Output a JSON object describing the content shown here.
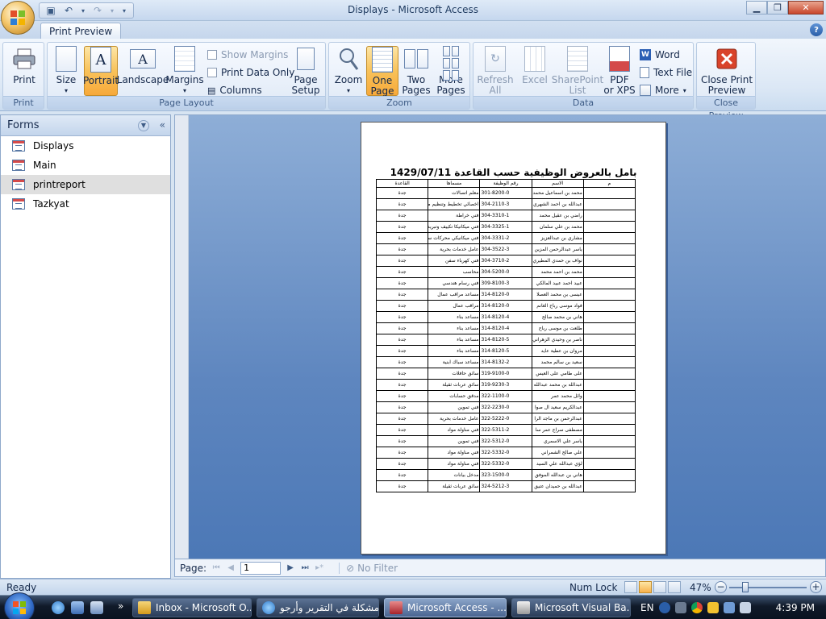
{
  "window": {
    "title": "Displays - Microsoft Access",
    "minimize_glyph": "▁",
    "restore_glyph": "❐",
    "close_glyph": "✕"
  },
  "ribbon": {
    "active_tab": "Print Preview",
    "help_glyph": "?",
    "groups": {
      "print": {
        "label": "Print",
        "print_btn": "Print"
      },
      "page_layout": {
        "label": "Page Layout",
        "size": "Size",
        "portrait": "Portrait",
        "landscape": "Landscape",
        "margins": "Margins",
        "show_margins": "Show Margins",
        "print_data_only": "Print Data Only",
        "columns": "Columns",
        "page_setup_1": "Page",
        "page_setup_2": "Setup"
      },
      "zoom": {
        "label": "Zoom",
        "zoom": "Zoom",
        "one_page_1": "One",
        "one_page_2": "Page",
        "two_pages_1": "Two",
        "two_pages_2": "Pages",
        "more_pages_1": "More",
        "more_pages_2": "Pages"
      },
      "data": {
        "label": "Data",
        "refresh_1": "Refresh",
        "refresh_2": "All",
        "excel": "Excel",
        "sharepoint_1": "SharePoint",
        "sharepoint_2": "List",
        "pdf_1": "PDF",
        "pdf_2": "or XPS",
        "word": "Word",
        "text_file": "Text File",
        "more": "More"
      },
      "close_preview": {
        "label": "Close Preview",
        "btn_1": "Close Print",
        "btn_2": "Preview"
      }
    }
  },
  "nav_pane": {
    "header": "Forms",
    "items": [
      "Displays",
      "Main",
      "printreport",
      "Tazkyat"
    ],
    "selected_index": 2
  },
  "report": {
    "title": "بامل بالعروض الوظيفية حسب القاعدة 1429/07/11",
    "headers": {
      "idx": "م",
      "name": "الاسم",
      "job_no": "رقم الوظيفة",
      "title": "مسماها",
      "base": "القاعدة"
    },
    "rows": [
      [
        "محمد بن اسماعيل محمد",
        "301-8200-0",
        "معلم اتصالات",
        "جدة"
      ],
      [
        "عبدالله بن احمد الشهري",
        "304-2110-3",
        "اخصائي تخطيط وتنظيم ميكانيكا",
        "جدة"
      ],
      [
        "راضي بن عقيل محمد",
        "304-3310-1",
        "فني خراطة",
        "جدة"
      ],
      [
        "محمد بن علي سلمان",
        "304-3325-1",
        "فني ميكانيكا تكييف وتبريد",
        "جدة"
      ],
      [
        "مشاري بن عبدالعزيز",
        "304-3331-2",
        "فني ميكانيكي محركات سفن",
        "جدة"
      ],
      [
        "ياسر عبدالرحمن المزين",
        "304-3522-3",
        "عامل خدمات بحرية",
        "جدة"
      ],
      [
        "نواف بن حمدي المطيري",
        "304-3710-2",
        "فني كهرباء سفن",
        "جدة"
      ],
      [
        "محمد بن احمد محمد",
        "304-5200-0",
        "محاسب",
        "جدة"
      ],
      [
        "عبيد احمد عبيد المالكي",
        "309-8100-3",
        "فني رسام هندسي",
        "جدة"
      ],
      [
        "عيسى بن محمد العصلا",
        "314-8120-0",
        "مساعد مراقب عمال",
        "جدة"
      ],
      [
        "فواد موسى رباح الغانم",
        "314-8120-0",
        "مراقب عمال",
        "جدة"
      ],
      [
        "هاني بن محمد صالح",
        "314-8120-4",
        "مساعد بناء",
        "جدة"
      ],
      [
        "طلعت بن موسى رباح",
        "314-8120-4",
        "مساعد بناء",
        "جدة"
      ],
      [
        "ناصر بن وحيدي الزهراني",
        "314-8120-5",
        "مساعد بناء",
        "جدة"
      ],
      [
        "مروان بن عطية عايد",
        "314-8120-5",
        "مساعد بناء",
        "جدة"
      ],
      [
        "سعيد بن سالم محمد",
        "314-8132-2",
        "مساعد سباك ابنية",
        "جدة"
      ],
      [
        "على طامي على العيس",
        "319-9100-0",
        "سائق حافلات",
        "جدة"
      ],
      [
        "عبدالله بن محمد عبدالله",
        "319-9230-3",
        "سائق عربات ثقيلة",
        "جدة"
      ],
      [
        "وائل محمد عمر",
        "322-1100-0",
        "مدقق حسابات",
        "جدة"
      ],
      [
        "عبدالكريم سعيد ال صوا",
        "322-2230-0",
        "فني تموين",
        "جدة"
      ],
      [
        "عبدالرحمن بن ماجد الرا",
        "322-5222-0",
        "عامل خدمات بحرية",
        "جدة"
      ],
      [
        "مصطفى سراج عمر سا",
        "322-5311-2",
        "فني مناولة مواد",
        "جدة"
      ],
      [
        "ياسر علي الاسمري",
        "322-5312-0",
        "فني تموين",
        "جدة"
      ],
      [
        "علي صالح الشمراني",
        "322-5332-0",
        "فني مناولة مواد",
        "جدة"
      ],
      [
        "لؤي عبدالله علي السيد",
        "322-5332-0",
        "فني مناولة مواد",
        "جدة"
      ],
      [
        "هاني بن عبدالله الموفق",
        "323-1500-0",
        "مدخل بيانات",
        "جدة"
      ],
      [
        "عبدالله بن حميدان عتيق",
        "324-5212-3",
        "سائق عربات ثقيلة",
        "جدة"
      ]
    ]
  },
  "pager": {
    "label": "Page:",
    "value": "1",
    "no_filter": "No Filter"
  },
  "status": {
    "ready": "Ready",
    "num_lock": "Num Lock",
    "zoom": "47%",
    "zoom_fraction": 0.47
  },
  "taskbar": {
    "tasks": [
      {
        "label": "Inbox - Microsoft O...",
        "active": false
      },
      {
        "label": "مشكلة في التقرير وأرجو...",
        "active": false
      },
      {
        "label": "Microsoft Access - ...",
        "active": true
      },
      {
        "label": "Microsoft Visual Ba...",
        "active": false
      }
    ],
    "lang": "EN",
    "clock": "4:39 PM"
  },
  "colors": {
    "accent_active": "#f8c25a",
    "preview_bg": "#5e86bf",
    "close_red": "#c9462b"
  }
}
